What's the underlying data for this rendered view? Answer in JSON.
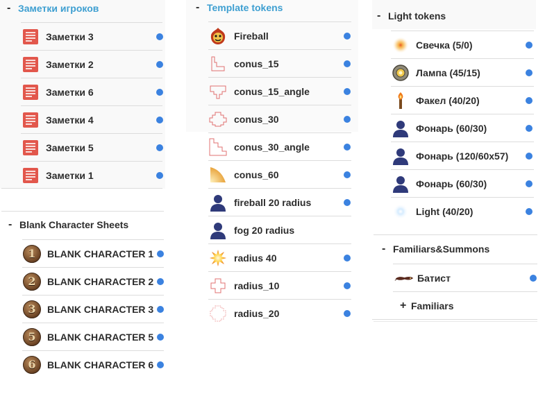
{
  "player_notes": {
    "title": "Заметки игроков",
    "items": [
      {
        "label": "Заметки 3"
      },
      {
        "label": "Заметки 2"
      },
      {
        "label": "Заметки 6"
      },
      {
        "label": "Заметки 4"
      },
      {
        "label": "Заметки 5"
      },
      {
        "label": "Заметки 1"
      }
    ]
  },
  "blank_sheets": {
    "sign": "-",
    "title": "Blank Character Sheets",
    "items": [
      {
        "label": "BLANK CHARACTER 1",
        "num": "1"
      },
      {
        "label": "BLANK CHARACTER 2",
        "num": "2"
      },
      {
        "label": "BLANK CHARACTER 3",
        "num": "3"
      },
      {
        "label": "BLANK CHARACTER 5",
        "num": "5"
      },
      {
        "label": "BLANK CHARACTER 6",
        "num": "6"
      }
    ]
  },
  "template_tokens": {
    "title": "Template tokens",
    "items": [
      {
        "label": "Fireball",
        "icon": "fireball-icon"
      },
      {
        "label": "conus_15",
        "icon": "conus-15-icon"
      },
      {
        "label": "conus_15_angle",
        "icon": "conus-15-angle-icon"
      },
      {
        "label": "conus_30",
        "icon": "conus-30-icon"
      },
      {
        "label": "conus_30_angle",
        "icon": "conus-30-angle-icon"
      },
      {
        "label": "conus_60",
        "icon": "conus-60-icon"
      },
      {
        "label": "fireball 20 radius",
        "icon": "person-icon"
      },
      {
        "label": "fog 20 radius",
        "icon": "person-icon"
      },
      {
        "label": "radius 40",
        "icon": "burst-icon"
      },
      {
        "label": "radius_10",
        "icon": "radius-10-icon"
      },
      {
        "label": "radius_20",
        "icon": "radius-20-icon"
      }
    ]
  },
  "light_tokens": {
    "sign": "-",
    "title": "Light tokens",
    "items": [
      {
        "label": "Свечка (5/0)",
        "icon": "candle-glow-icon"
      },
      {
        "label": "Лампа (45/15)",
        "icon": "lamp-icon"
      },
      {
        "label": "Факел (40/20)",
        "icon": "torch-icon"
      },
      {
        "label": "Фонарь (60/30)",
        "icon": "person-icon"
      },
      {
        "label": "Фонарь (120/60x57)",
        "icon": "person-icon"
      },
      {
        "label": "Фонарь (60/30)",
        "icon": "person-icon"
      },
      {
        "label": "Light (40/20)",
        "icon": "light-glow-icon"
      }
    ]
  },
  "familiars": {
    "sign": "-",
    "title": "Familiars&Summons",
    "items": [
      {
        "label": "Батист",
        "icon": "creature-icon"
      }
    ],
    "subfolder": {
      "sign": "+",
      "title": "Familiars"
    }
  },
  "colors": {
    "accent_title": "#3e9fd1",
    "dot": "#3b82e0",
    "notes_icon": "#e2574c",
    "person": "#2f3a7a"
  }
}
